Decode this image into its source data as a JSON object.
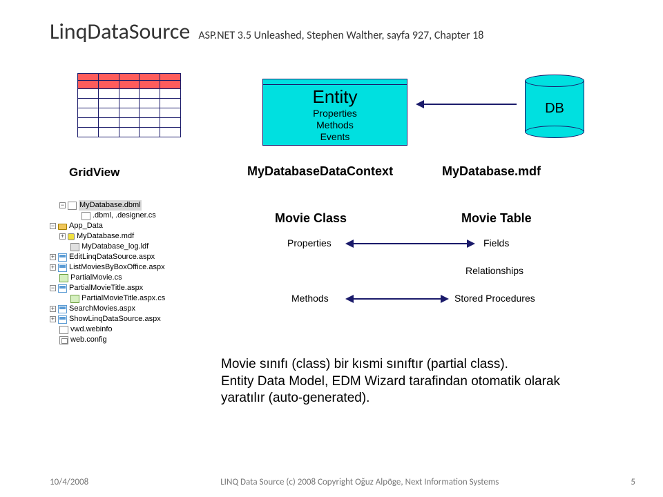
{
  "header": {
    "title": "LinqDataSource",
    "subtitle": "ASP.NET 3.5 Unleashed, Stephen Walther, sayfa 927, Chapter 18"
  },
  "entity": {
    "title": "Entity",
    "l1": "Properties",
    "l2": "Methods",
    "l3": "Events"
  },
  "db": {
    "label": "DB"
  },
  "labels": {
    "gridview": "GridView",
    "ctx": "MyDatabaseDataContext",
    "mdf": "MyDatabase.mdf",
    "movieclass": "Movie Class",
    "movietable": "Movie Table",
    "props": "Properties",
    "fields": "Fields",
    "rel": "Relationships",
    "methods": "Methods",
    "sp": "Stored Procedures"
  },
  "para": {
    "l1": "Movie sınıfı (class) bir kısmi sınıftır (partial class).",
    "l2": "Entity Data Model, EDM Wizard tarafindan otomatik olarak yaratılır (auto-generated)."
  },
  "tree": {
    "n0": "MyDatabase.dbml",
    "n1": ".dbml, .designer.cs",
    "n2": "App_Data",
    "n3": "MyDatabase.mdf",
    "n4": "MyDatabase_log.ldf",
    "n5": "EditLinqDataSource.aspx",
    "n6": "ListMoviesByBoxOffice.aspx",
    "n7": "PartialMovie.cs",
    "n8": "PartialMovieTitle.aspx",
    "n9": "PartialMovieTitle.aspx.cs",
    "n10": "SearchMovies.aspx",
    "n11": "ShowLinqDataSource.aspx",
    "n12": "vwd.webinfo",
    "n13": "web.config"
  },
  "footer": {
    "date": "10/4/2008",
    "center": "LINQ Data Source (c) 2008 Copyright Oğuz Alpöge, Next Information Systems",
    "page": "5"
  }
}
